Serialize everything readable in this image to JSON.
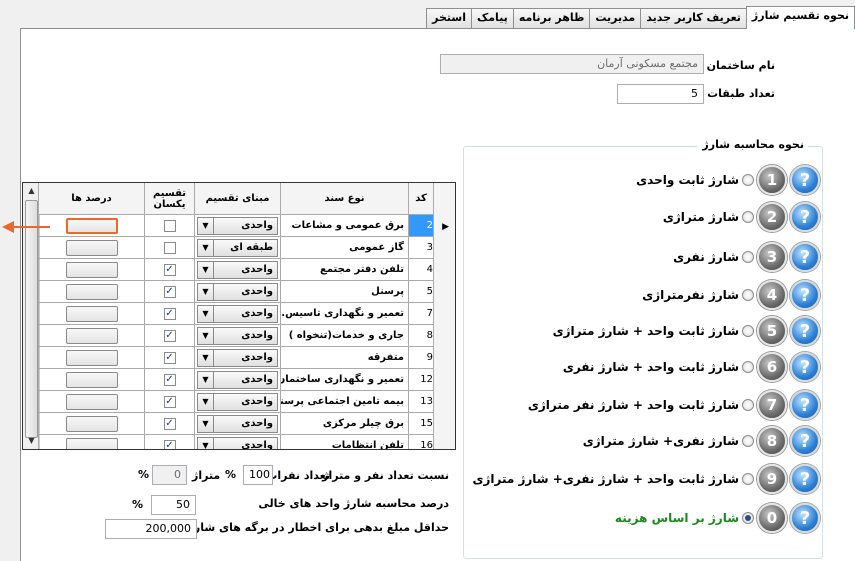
{
  "tabs": [
    "نحوه تقسیم شارژ",
    "تعریف کاربر جدید",
    "مدیریت",
    "ظاهر برنامه",
    "پیامک",
    "استخر"
  ],
  "building": {
    "name_label": "نام ساختمان :",
    "name_value": "مجتمع مسکونی آرمان",
    "floors_label": "تعداد طبقات :",
    "floors_value": "5"
  },
  "calc_group": {
    "title": "نحوه محاسبه شارژ",
    "options": [
      {
        "num": "1",
        "label": "شارژ ثابت واحدی",
        "selected": false,
        "green": false
      },
      {
        "num": "2",
        "label": "شارژ متراژی",
        "selected": false,
        "green": false
      },
      {
        "num": "3",
        "label": "شارژ نفری",
        "selected": false,
        "green": false
      },
      {
        "num": "4",
        "label": "شارژ نفرمتراژی",
        "selected": false,
        "green": false
      },
      {
        "num": "5",
        "label": "شارژ ثابت واحد + شارژ متراژی",
        "selected": false,
        "green": false
      },
      {
        "num": "6",
        "label": "شارژ ثابت واحد + شارژ نفری",
        "selected": false,
        "green": false
      },
      {
        "num": "7",
        "label": "شارژ ثابت واحد + شارژ نفر متراژی",
        "selected": false,
        "green": false
      },
      {
        "num": "8",
        "label": "شارژ نفری+ شارژ متراژی",
        "selected": false,
        "green": false
      },
      {
        "num": "9",
        "label": "شارژ ثابت واحد + شارژ نفری+ شارژ متراژی",
        "selected": false,
        "green": false
      },
      {
        "num": "0",
        "label": "شارژ بر اساس هزینه",
        "selected": true,
        "green": true
      }
    ],
    "help_icon": "question-icon"
  },
  "grid": {
    "headers": {
      "code": "کد",
      "doc_type": "نوع سند",
      "base": "مبنای تقسیم",
      "equal": "تقسیم یکسان",
      "percent": "درصد ها"
    },
    "rows": [
      {
        "code": "2",
        "name": "برق عمومی و مشاعات",
        "base": "واحدی",
        "equal": false,
        "selected": true
      },
      {
        "code": "3",
        "name": "گاز عمومی",
        "base": "طبقه ای",
        "equal": false,
        "selected": false
      },
      {
        "code": "4",
        "name": "تلفن دفتر مجتمع",
        "base": "واحدی",
        "equal": true,
        "selected": false
      },
      {
        "code": "5",
        "name": "پرسنل",
        "base": "واحدی",
        "equal": true,
        "selected": false
      },
      {
        "code": "7",
        "name": "تعمیر و نگهداری تاسیس...",
        "base": "واحدی",
        "equal": true,
        "selected": false
      },
      {
        "code": "8",
        "name": "جاری و خدمات(تنخواه )",
        "base": "واحدی",
        "equal": true,
        "selected": false
      },
      {
        "code": "9",
        "name": "متفرقه",
        "base": "واحدی",
        "equal": true,
        "selected": false
      },
      {
        "code": "12",
        "name": "تعمیر و نگهداری ساختمان",
        "base": "واحدی",
        "equal": true,
        "selected": false
      },
      {
        "code": "13",
        "name": "بیمه تامین اجتماعی پرسنل",
        "base": "واحدی",
        "equal": true,
        "selected": false
      },
      {
        "code": "15",
        "name": "برق چیلر مرکزی",
        "base": "واحدی",
        "equal": true,
        "selected": false
      },
      {
        "code": "16",
        "name": "تلفن انتظامات",
        "base": "واحدی",
        "equal": true,
        "selected": false
      }
    ]
  },
  "ratio": {
    "label": "نسبت تعداد نفر و متراژ",
    "persons_label": "تعداد نفرات",
    "persons_value": "100",
    "persons_unit": "%",
    "area_label": "متراژ",
    "area_value": "0",
    "area_unit": "%"
  },
  "empty_units": {
    "label": "درصد محاسبه شارژ واحد های خالی",
    "value": "50",
    "unit": "%"
  },
  "min_debt": {
    "label": "حداقل مبلغ بدهی برای اخطار در برگه های شارژ به ریال",
    "value": "200,000"
  }
}
